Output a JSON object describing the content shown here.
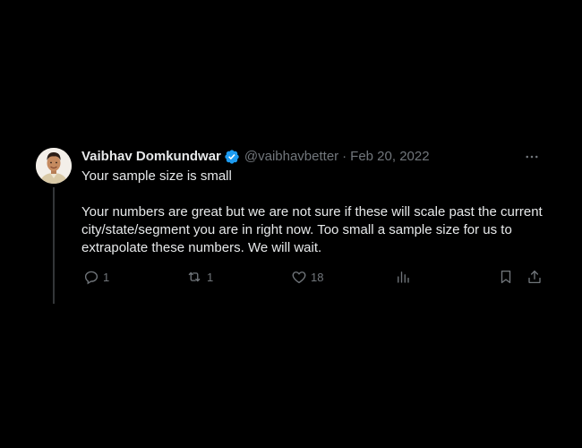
{
  "tweet": {
    "author_name": "Vaibhav Domkundwar",
    "handle": "@vaibhavbetter",
    "separator": "·",
    "date": "Feb 20, 2022",
    "paragraphs": [
      "Your sample size is small",
      "Your numbers are great but we are not sure if these will scale past the current city/state/segment you are in right now. Too small a sample size for us to extrapolate these numbers. We will wait."
    ],
    "verified": true
  },
  "actions": {
    "reply_count": "1",
    "retweet_count": "1",
    "like_count": "18"
  },
  "icons": {
    "more": "more-horizontal-icon",
    "reply": "reply-icon",
    "retweet": "retweet-icon",
    "like": "heart-icon",
    "views": "analytics-icon",
    "bookmark": "bookmark-icon",
    "share": "share-icon",
    "verified": "verified-badge-icon"
  },
  "colors": {
    "background": "#000000",
    "text": "#e7e9ea",
    "secondary": "#71767b",
    "verified": "#1d9bf0",
    "thread_line": "#333639"
  }
}
